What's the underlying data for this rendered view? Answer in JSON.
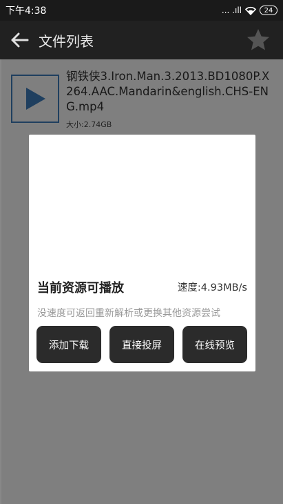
{
  "status_bar": {
    "time": "下午4:38",
    "signal_text": "... .ıll",
    "battery": "24"
  },
  "app_bar": {
    "title": "文件列表"
  },
  "file": {
    "name": "钢铁侠3.Iron.Man.3.2013.BD1080P.X264.AAC.Mandarin&english.CHS-ENG.mp4",
    "size": "大小:2.74GB"
  },
  "dialog": {
    "status": "当前资源可播放",
    "speed": "速度:4.93MB/s",
    "hint": "没速度可返回重新解析或更换其他资源尝试",
    "buttons": {
      "download": "添加下载",
      "cast": "直接投屏",
      "preview": "在线预览"
    }
  },
  "colors": {
    "app_bar": "#212121",
    "status_bar": "#1a1a1a",
    "thumb_accent": "#3f7fbf",
    "button_bg": "#2b2b2b"
  }
}
